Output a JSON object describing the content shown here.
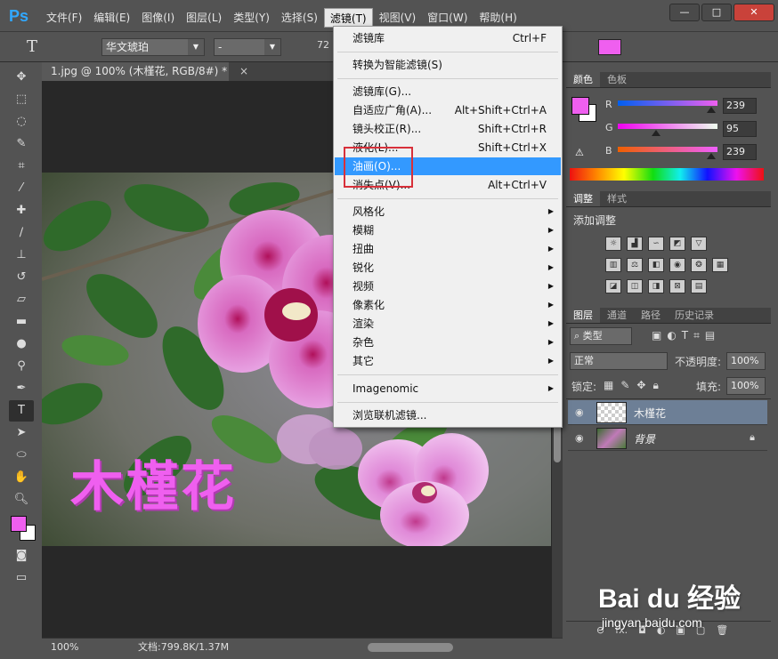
{
  "app": {
    "logo": "Ps"
  },
  "menubar": {
    "items": [
      "文件(F)",
      "编辑(E)",
      "图像(I)",
      "图层(L)",
      "类型(Y)",
      "选择(S)",
      "滤镜(T)",
      "视图(V)",
      "窗口(W)",
      "帮助(H)"
    ],
    "active_index": 6,
    "window_buttons": [
      "—",
      "□",
      "✕"
    ]
  },
  "options": {
    "tool_glyph": "T",
    "font_family": "华文琥珀",
    "font_style": "-",
    "font_size_partial": "72",
    "text_color": "#ef5fef"
  },
  "document": {
    "tab_title": "1.jpg @ 100% (木槿花, RGB/8#) *",
    "tab_close": "×",
    "overlay_text": "木槿花",
    "zoom": "100%",
    "doc_info": "文档:799.8K/1.37M"
  },
  "filter_menu": {
    "last_filter": {
      "label": "滤镜库",
      "shortcut": "Ctrl+F"
    },
    "convert_smart": "转换为智能滤镜(S)",
    "group1": [
      {
        "label": "滤镜库(G)...",
        "shortcut": ""
      },
      {
        "label": "自适应广角(A)...",
        "shortcut": "Alt+Shift+Ctrl+A"
      },
      {
        "label": "镜头校正(R)...",
        "shortcut": "Shift+Ctrl+R"
      },
      {
        "label": "液化(L)...",
        "shortcut": "Shift+Ctrl+X"
      },
      {
        "label": "油画(O)...",
        "shortcut": ""
      },
      {
        "label": "消失点(V)...",
        "shortcut": "Alt+Ctrl+V"
      }
    ],
    "highlighted_index": 4,
    "submenus": [
      "风格化",
      "模糊",
      "扭曲",
      "锐化",
      "视频",
      "像素化",
      "渲染",
      "杂色",
      "其它"
    ],
    "plugin": "Imagenomic",
    "browse": "浏览联机滤镜..."
  },
  "color_panel": {
    "tabs": [
      "颜色",
      "色板"
    ],
    "channels": [
      {
        "label": "R",
        "value": "239"
      },
      {
        "label": "G",
        "value": "95"
      },
      {
        "label": "B",
        "value": "239"
      }
    ],
    "fg_color": "#ef5fef",
    "bg_color": "#ffffff"
  },
  "adjust_panel": {
    "tabs": [
      "调整",
      "样式"
    ],
    "title": "添加调整"
  },
  "layers_panel": {
    "tabs": [
      "图层",
      "通道",
      "路径",
      "历史记录"
    ],
    "filter_kind": "类型",
    "blend_mode": "正常",
    "opacity_label": "不透明度:",
    "opacity_value": "100%",
    "lock_label": "锁定:",
    "fill_label": "填充:",
    "fill_value": "100%",
    "layers": [
      {
        "name": "木槿花",
        "selected": true,
        "kind": "text"
      },
      {
        "name": "背景",
        "selected": false,
        "kind": "image"
      }
    ],
    "bottom_icons": [
      "⊖",
      "fx.",
      "◘",
      "◐",
      "▣",
      "▢",
      "🗑"
    ]
  },
  "watermark": {
    "main": "Bai du 经验",
    "sub": "jingyan.baidu.com"
  }
}
